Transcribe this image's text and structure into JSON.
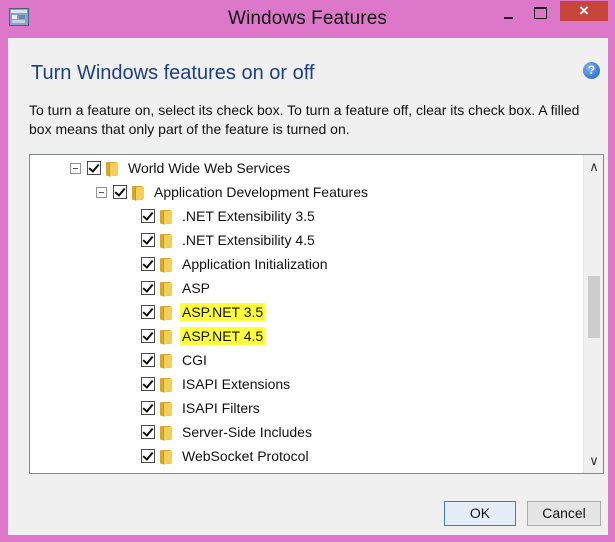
{
  "window": {
    "title": "Windows Features",
    "accent_color": "#dc77c9",
    "close_label": "×"
  },
  "header": {
    "title": "Turn Windows features on or off",
    "help_label": "?",
    "instructions": "To turn a feature on, select its check box. To turn a feature off, clear its check box. A filled box means that only part of the feature is turned on."
  },
  "tree": {
    "items": [
      {
        "label": "World Wide Web Services",
        "level": 0,
        "expanded": true,
        "checked": true,
        "highlighted": false
      },
      {
        "label": "Application Development Features",
        "level": 1,
        "expanded": true,
        "checked": true,
        "highlighted": false
      },
      {
        "label": ".NET Extensibility 3.5",
        "level": 2,
        "checked": true,
        "highlighted": false
      },
      {
        "label": ".NET Extensibility 4.5",
        "level": 2,
        "checked": true,
        "highlighted": false
      },
      {
        "label": "Application Initialization",
        "level": 2,
        "checked": true,
        "highlighted": false
      },
      {
        "label": "ASP",
        "level": 2,
        "checked": true,
        "highlighted": false
      },
      {
        "label": "ASP.NET 3.5",
        "level": 2,
        "checked": true,
        "highlighted": true
      },
      {
        "label": "ASP.NET 4.5",
        "level": 2,
        "checked": true,
        "highlighted": true
      },
      {
        "label": "CGI",
        "level": 2,
        "checked": true,
        "highlighted": false
      },
      {
        "label": "ISAPI Extensions",
        "level": 2,
        "checked": true,
        "highlighted": false
      },
      {
        "label": "ISAPI Filters",
        "level": 2,
        "checked": true,
        "highlighted": false
      },
      {
        "label": "Server-Side Includes",
        "level": 2,
        "checked": true,
        "highlighted": false
      },
      {
        "label": "WebSocket Protocol",
        "level": 2,
        "checked": true,
        "highlighted": false
      }
    ],
    "highlight_color": "#ffff3c",
    "scroll_up_label": "∧",
    "scroll_down_label": "∨"
  },
  "footer": {
    "ok_label": "OK",
    "cancel_label": "Cancel"
  }
}
